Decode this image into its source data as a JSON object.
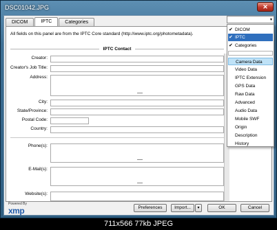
{
  "window": {
    "title": "DSC01042.JPG",
    "close_label": "✕"
  },
  "tabs": [
    "DICOM",
    "IPTC",
    "Categories"
  ],
  "notice": "All fields on this panel are from the IPTC Core standard (http://www.iptc.org/photometadata).",
  "section_title": "IPTC Contact",
  "fields": {
    "creator": "Creator:",
    "job_title": "Creator's Job Title:",
    "address": "Address:",
    "city": "City:",
    "state": "State/Province:",
    "postal": "Postal Code:",
    "country": "Country:",
    "phones": "Phone(s):",
    "emails": "E-Mail(s):",
    "websites": "Website(s):"
  },
  "logo": {
    "powered_by": "Powered By",
    "brand": "xmp"
  },
  "buttons": {
    "preferences": "Preferences",
    "import": "Import...",
    "ok": "OK",
    "cancel": "Cancel",
    "arrow": "▾"
  },
  "dropdown": {
    "arrow": "▾",
    "checked": [
      "DICOM",
      "IPTC",
      "Categories"
    ],
    "items": [
      "Camera Data",
      "Video Data",
      "IPTC Extension",
      "GPS Data",
      "Raw Data",
      "Advanced",
      "Audio Data",
      "Mobile SWF",
      "Origin",
      "Description",
      "History"
    ],
    "check": "✔"
  },
  "caption": "711x566  77kb  JPEG"
}
